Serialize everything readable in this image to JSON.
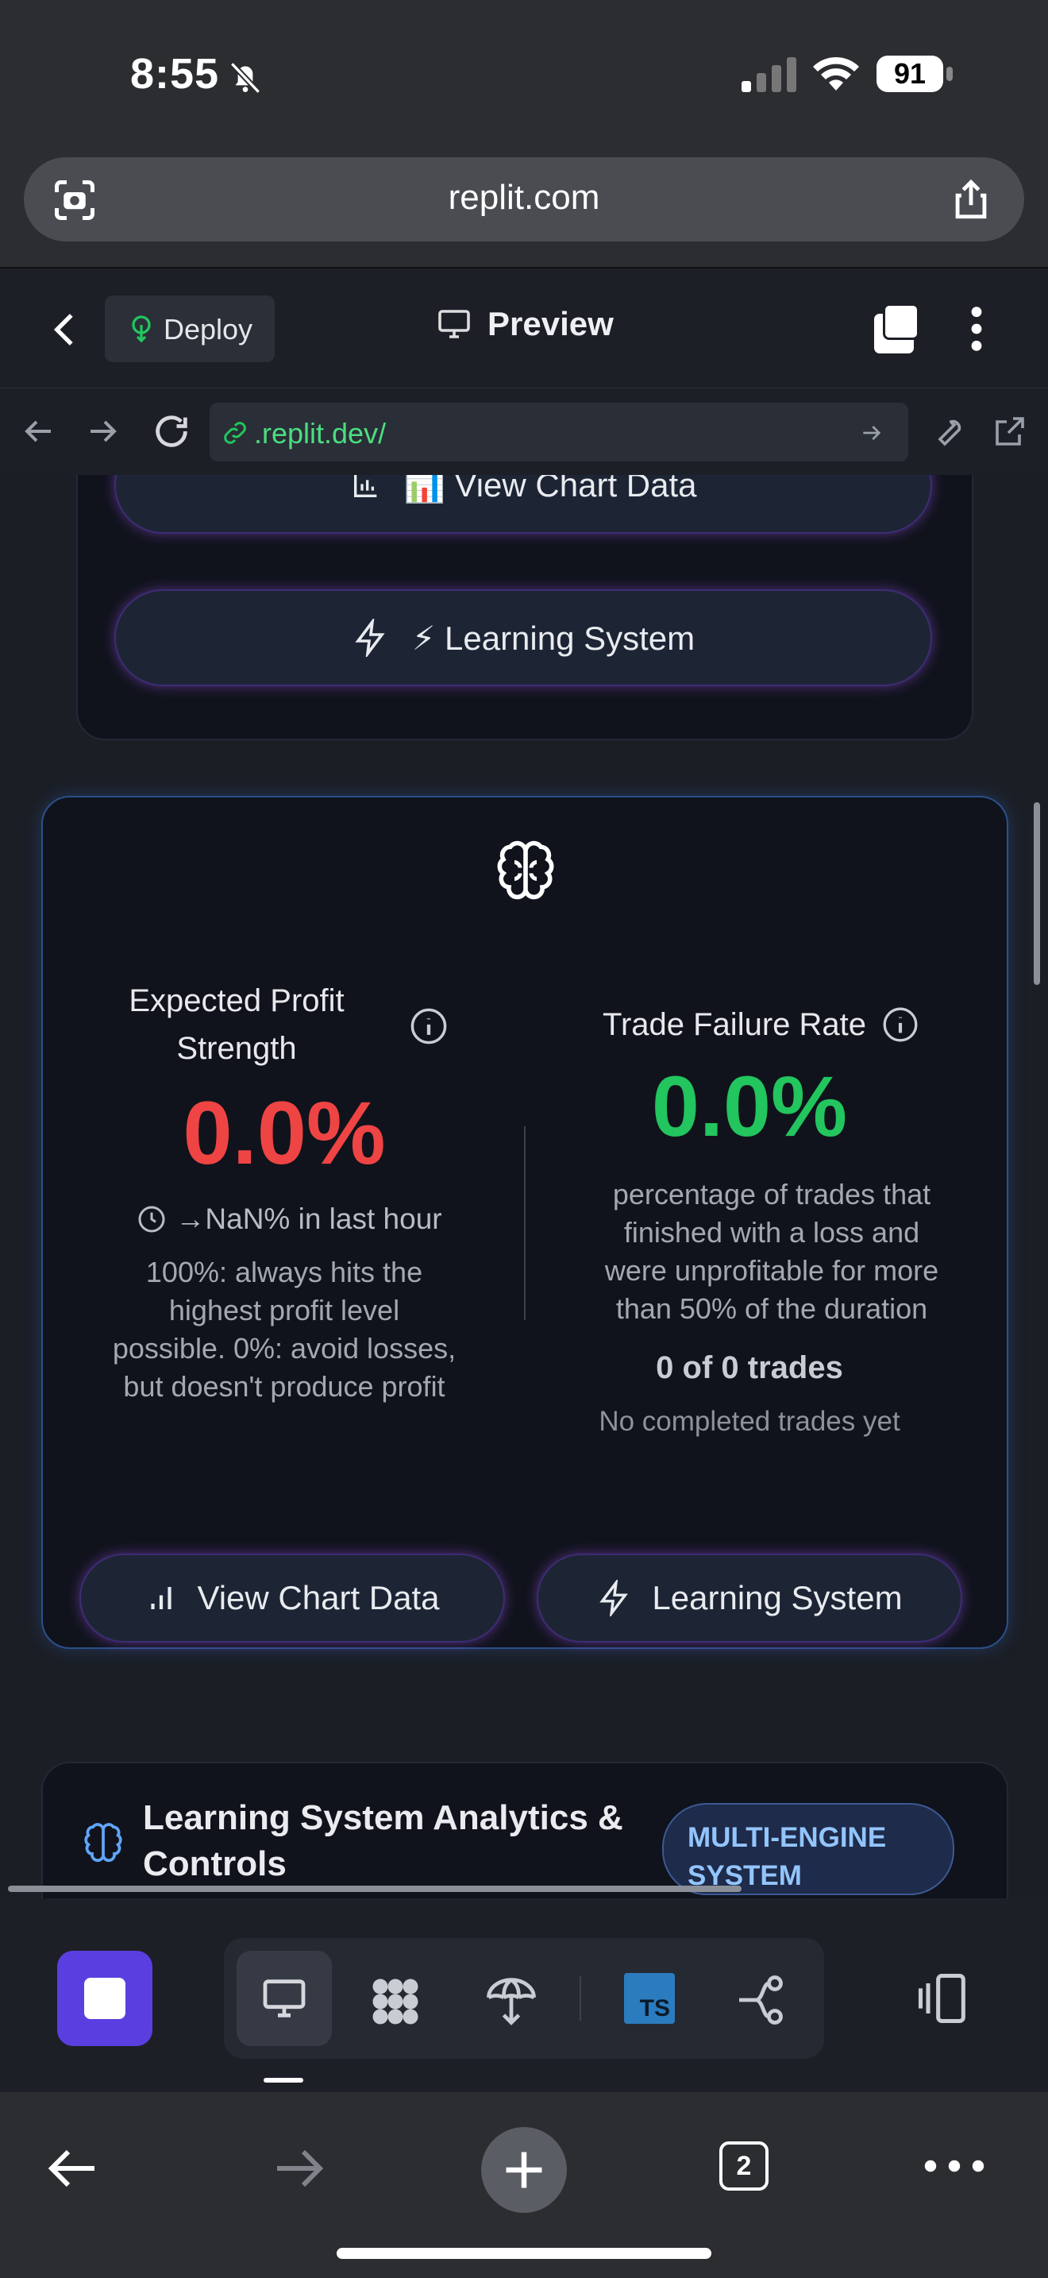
{
  "status": {
    "time": "8:55",
    "battery": "91"
  },
  "safari": {
    "url": "replit.com"
  },
  "replit_header": {
    "deploy_label": "Deploy",
    "preview_label": "Preview"
  },
  "browser": {
    "address": ".replit.dev/"
  },
  "top_card": {
    "chart_button": "📊 View Chart Data",
    "learning_button": "⚡ Learning System"
  },
  "metrics_card": {
    "profit": {
      "title": "Expected Profit Strength",
      "value": "0.0%",
      "change": "→NaN% in last hour",
      "description": "100%: always hits the highest profit level possible. 0%: avoid losses, but doesn't produce profit"
    },
    "failure": {
      "title": "Trade Failure Rate",
      "value": "0.0%",
      "description": "percentage of trades that finished with a loss and were unprofitable for more than 50% of the duration",
      "count": "0 of 0 trades",
      "note": "No completed trades yet"
    },
    "chart_button": "View Chart Data",
    "learning_button": "Learning System"
  },
  "analytics_card": {
    "title": "Learning System Analytics & Controls",
    "badge": "MULTI-ENGINE SYSTEM"
  },
  "colors": {
    "red": "#ef4444",
    "green": "#22c55e",
    "accent": "#5b3ee0",
    "blue_badge": "#93c5fd"
  },
  "safari_bar": {
    "tab_count": "2"
  }
}
